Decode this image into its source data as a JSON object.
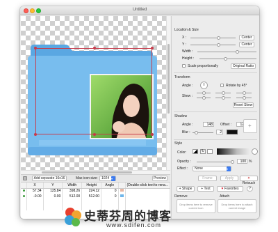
{
  "window": {
    "title": "Untitled"
  },
  "bottom_bar": {
    "add_separate_label": "Add separate 16x16",
    "max_icon_size_label": "Max icon size:",
    "max_icon_size_value": "1024",
    "preview_label": "Preview"
  },
  "table": {
    "headers": [
      "X",
      "Y",
      "Width",
      "Height",
      "Angle",
      "",
      "(Double-click text to rena..."
    ],
    "rows": [
      [
        "57.34",
        "125.84",
        "398.26",
        "224.12",
        "0"
      ],
      [
        "-0.00",
        "0.00",
        "512.00",
        "512.00",
        "0"
      ]
    ]
  },
  "location_size": {
    "title": "Location & Size",
    "x_label": "X :",
    "y_label": "Y :",
    "width_label": "Width :",
    "height_label": "Height :",
    "center_label": "Center",
    "scale_label": "Scale proportionally",
    "original_ratio_label": "Original Ratio"
  },
  "transform": {
    "title": "Transform",
    "angle_label": "Angle :",
    "rotate_label": "Rotate by 45°",
    "skew_label": "Skew :",
    "reset_skew_label": "Reset Skew"
  },
  "shadow": {
    "title": "Shadow",
    "angle_label": "Angle :",
    "angle_value": "148",
    "offset_label": "Offset :",
    "offset_value": "12",
    "blur_label": "Blur :",
    "blur_value": "2"
  },
  "style": {
    "title": "Style",
    "color_label": "Color:",
    "opacity_label": "Opacity :",
    "opacity_value": "100",
    "opacity_unit": "%",
    "effect_label": "Effect :",
    "effect_value": "None"
  },
  "actions": {
    "frame_label": "Frame",
    "apply_label": "Apply",
    "retouch_label": "Retouch",
    "shape_label": "Shape",
    "text_label": "Text",
    "favorites_label": "Favorites",
    "help_label": "?"
  },
  "remove": {
    "title": "Remove",
    "hint": "Drop items here to remove current icon"
  },
  "attach": {
    "title": "Attach",
    "hint": "Drop items here to attach current image"
  },
  "watermark": {
    "text": "史蒂芬周的博客",
    "url": "www.sdifen.com"
  },
  "colors": {
    "folder": "#6fb6ea",
    "folder_dark": "#4a94d3",
    "selection": "#c73a4a",
    "watermark": "#2b2b2b"
  },
  "icons": [
    "close-icon",
    "minimize-icon",
    "zoom-icon",
    "folder-icon",
    "plus-icon",
    "star-icon"
  ]
}
